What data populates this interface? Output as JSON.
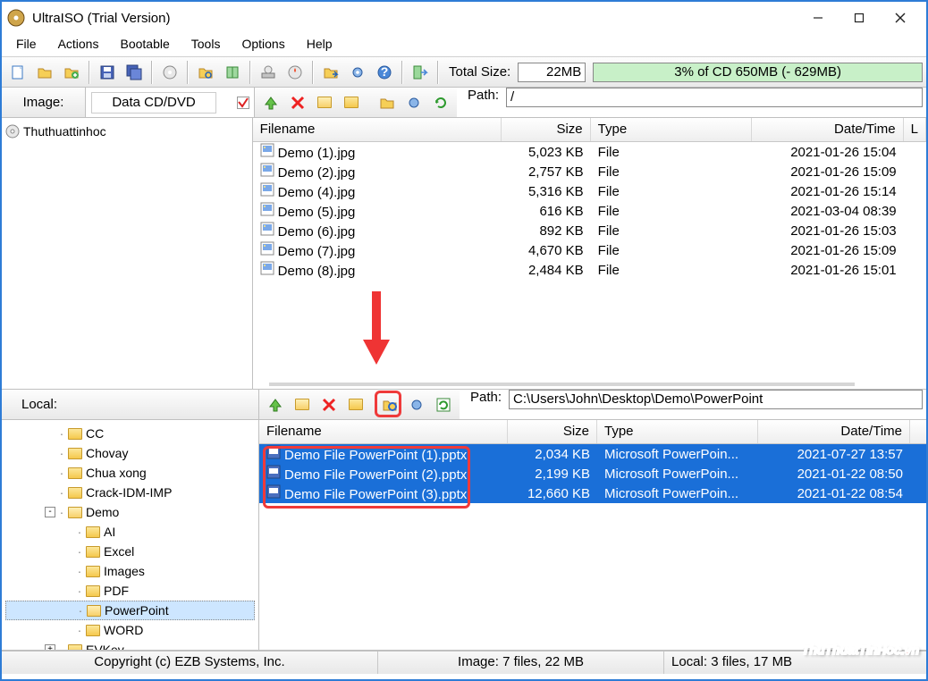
{
  "titlebar": {
    "title": "UltraISO (Trial Version)"
  },
  "menu": {
    "file": "File",
    "actions": "Actions",
    "bootable": "Bootable",
    "tools": "Tools",
    "options": "Options",
    "help": "Help"
  },
  "sizebar": {
    "label": "Total Size:",
    "value": "22MB",
    "capacity": "3% of CD 650MB (- 629MB)"
  },
  "imagebar": {
    "label": "Image:",
    "volname": "Data CD/DVD",
    "pathlabel": "Path:",
    "path": "/"
  },
  "localbar": {
    "label": "Local:",
    "pathlabel": "Path:",
    "path": "C:\\Users\\John\\Desktop\\Demo\\PowerPoint"
  },
  "columns": {
    "name": "Filename",
    "size": "Size",
    "type": "Type",
    "date": "Date/Time",
    "l": "L"
  },
  "imageTree": {
    "root": "Thuthuattinhoc"
  },
  "imageFiles": [
    {
      "name": "Demo (1).jpg",
      "size": "5,023 KB",
      "type": "File",
      "date": "2021-01-26 15:04"
    },
    {
      "name": "Demo (2).jpg",
      "size": "2,757 KB",
      "type": "File",
      "date": "2021-01-26 15:09"
    },
    {
      "name": "Demo (4).jpg",
      "size": "5,316 KB",
      "type": "File",
      "date": "2021-01-26 15:14"
    },
    {
      "name": "Demo (5).jpg",
      "size": "616 KB",
      "type": "File",
      "date": "2021-03-04 08:39"
    },
    {
      "name": "Demo (6).jpg",
      "size": "892 KB",
      "type": "File",
      "date": "2021-01-26 15:03"
    },
    {
      "name": "Demo (7).jpg",
      "size": "4,670 KB",
      "type": "File",
      "date": "2021-01-26 15:09"
    },
    {
      "name": "Demo (8).jpg",
      "size": "2,484 KB",
      "type": "File",
      "date": "2021-01-26 15:01"
    }
  ],
  "localTree": [
    {
      "depth": 2,
      "name": "CC",
      "exp": ""
    },
    {
      "depth": 2,
      "name": "Chovay",
      "exp": ""
    },
    {
      "depth": 2,
      "name": "Chua xong",
      "exp": ""
    },
    {
      "depth": 2,
      "name": "Crack-IDM-IMP",
      "exp": ""
    },
    {
      "depth": 2,
      "name": "Demo",
      "exp": "-",
      "open": true
    },
    {
      "depth": 3,
      "name": "AI",
      "exp": ""
    },
    {
      "depth": 3,
      "name": "Excel",
      "exp": ""
    },
    {
      "depth": 3,
      "name": "Images",
      "exp": ""
    },
    {
      "depth": 3,
      "name": "PDF",
      "exp": ""
    },
    {
      "depth": 3,
      "name": "PowerPoint",
      "exp": "",
      "selected": true,
      "open": true
    },
    {
      "depth": 3,
      "name": "WORD",
      "exp": ""
    },
    {
      "depth": 2,
      "name": "EVKey",
      "exp": "+"
    }
  ],
  "localFiles": [
    {
      "name": "Demo File PowerPoint (1).pptx",
      "size": "2,034 KB",
      "type": "Microsoft PowerPoin...",
      "date": "2021-07-27 13:57"
    },
    {
      "name": "Demo File PowerPoint (2).pptx",
      "size": "2,199 KB",
      "type": "Microsoft PowerPoin...",
      "date": "2021-01-22 08:50"
    },
    {
      "name": "Demo File PowerPoint (3).pptx",
      "size": "12,660 KB",
      "type": "Microsoft PowerPoin...",
      "date": "2021-01-22 08:54"
    }
  ],
  "statusbar": {
    "copyright": "Copyright (c) EZB Systems, Inc.",
    "image_info": "Image: 7 files, 22 MB",
    "local_info": "Local: 3 files, 17 MB"
  },
  "watermark": {
    "main": "ThuThuatTinHoc",
    "suffix": ".vn"
  }
}
